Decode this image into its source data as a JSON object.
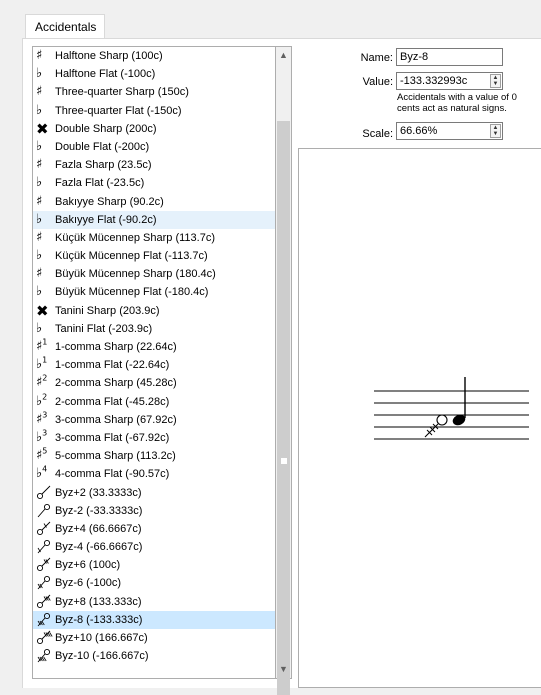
{
  "tab": {
    "label": "Accidentals"
  },
  "form": {
    "name_label": "Name:",
    "name_value": "Byz-8",
    "value_label": "Value:",
    "value_value": "-133.332993c",
    "value_note": "Accidentals with a value of 0 cents act as natural signs.",
    "scale_label": "Scale:",
    "scale_value": "66.66%"
  },
  "list": {
    "items": [
      {
        "symbol": "♯",
        "label": "Halftone Sharp (100c)",
        "sym_icon": "sharp-icon"
      },
      {
        "symbol": "♭",
        "label": "Halftone Flat (-100c)",
        "sym_icon": "flat-icon"
      },
      {
        "symbol": "♯",
        "label": "Three-quarter Sharp (150c)",
        "sym_icon": "three-quarter-sharp-icon"
      },
      {
        "symbol": "♭",
        "label": "Three-quarter Flat (-150c)",
        "sym_icon": "three-quarter-flat-icon"
      },
      {
        "symbol": "✖",
        "label": "Double Sharp (200c)",
        "sym_icon": "double-sharp-icon"
      },
      {
        "symbol": "♭",
        "label": "Double Flat (-200c)",
        "sym_icon": "double-flat-icon"
      },
      {
        "symbol": "♯",
        "label": "Fazla Sharp (23.5c)",
        "sym_icon": "fazla-sharp-icon"
      },
      {
        "symbol": "♭",
        "label": "Fazla Flat (-23.5c)",
        "sym_icon": "fazla-flat-icon"
      },
      {
        "symbol": "♯",
        "label": "Bakıyye Sharp (90.2c)",
        "sym_icon": "bakiyye-sharp-icon"
      },
      {
        "symbol": "♭",
        "label": "Bakıyye Flat (-90.2c)",
        "sym_icon": "bakiyye-flat-icon"
      },
      {
        "symbol": "♯",
        "label": "Küçük Mücennep Sharp (113.7c)",
        "sym_icon": "kucuk-mucennep-sharp-icon"
      },
      {
        "symbol": "♭",
        "label": "Küçük Mücennep Flat (-113.7c)",
        "sym_icon": "kucuk-mucennep-flat-icon"
      },
      {
        "symbol": "♯",
        "label": "Büyük Mücennep Sharp (180.4c)",
        "sym_icon": "buyuk-mucennep-sharp-icon"
      },
      {
        "symbol": "♭",
        "label": "Büyük Mücennep Flat (-180.4c)",
        "sym_icon": "buyuk-mucennep-flat-icon"
      },
      {
        "symbol": "✖",
        "label": "Tanini Sharp (203.9c)",
        "sym_icon": "tanini-sharp-icon"
      },
      {
        "symbol": "♭",
        "label": "Tanini Flat (-203.9c)",
        "sym_icon": "tanini-flat-icon"
      },
      {
        "symbol": "♯",
        "sup": "1",
        "label": "1-comma Sharp (22.64c)",
        "sym_icon": "comma-sharp-icon"
      },
      {
        "symbol": "♭",
        "sup": "1",
        "label": "1-comma Flat (-22.64c)",
        "sym_icon": "comma-flat-icon"
      },
      {
        "symbol": "♯",
        "sup": "2",
        "label": "2-comma Sharp (45.28c)",
        "sym_icon": "comma-sharp-icon"
      },
      {
        "symbol": "♭",
        "sup": "2",
        "label": "2-comma Flat (-45.28c)",
        "sym_icon": "comma-flat-icon"
      },
      {
        "symbol": "♯",
        "sup": "3",
        "label": "3-comma Sharp (67.92c)",
        "sym_icon": "comma-sharp-icon"
      },
      {
        "symbol": "♭",
        "sup": "3",
        "label": "3-comma Flat (-67.92c)",
        "sym_icon": "comma-flat-icon"
      },
      {
        "symbol": "♯",
        "sup": "5",
        "label": "5-comma Sharp (113.2c)",
        "sym_icon": "comma-sharp-icon"
      },
      {
        "symbol": "♭",
        "sup": "4",
        "label": "4-comma Flat (-90.57c)",
        "sym_icon": "comma-flat-icon"
      },
      {
        "label": "Byz+2 (33.3333c)",
        "sym_icon": "byzantine-sharp-icon",
        "svg": "up",
        "hatch": 0
      },
      {
        "label": "Byz-2 (-33.3333c)",
        "sym_icon": "byzantine-flat-icon",
        "svg": "down",
        "hatch": 0
      },
      {
        "label": "Byz+4 (66.6667c)",
        "sym_icon": "byzantine-sharp-icon",
        "svg": "up",
        "hatch": 1
      },
      {
        "label": "Byz-4 (-66.6667c)",
        "sym_icon": "byzantine-flat-icon",
        "svg": "down",
        "hatch": 1
      },
      {
        "label": "Byz+6 (100c)",
        "sym_icon": "byzantine-sharp-icon",
        "svg": "up",
        "hatch": 2
      },
      {
        "label": "Byz-6 (-100c)",
        "sym_icon": "byzantine-flat-icon",
        "svg": "down",
        "hatch": 2
      },
      {
        "label": "Byz+8 (133.333c)",
        "sym_icon": "byzantine-sharp-icon",
        "svg": "up",
        "hatch": 3
      },
      {
        "label": "Byz-8 (-133.333c)",
        "sym_icon": "byzantine-flat-icon",
        "svg": "down",
        "hatch": 3
      },
      {
        "label": "Byz+10 (166.667c)",
        "sym_icon": "byzantine-sharp-icon",
        "svg": "up",
        "hatch": 4
      },
      {
        "label": "Byz-10 (-166.667c)",
        "sym_icon": "byzantine-flat-icon",
        "svg": "down",
        "hatch": 4
      }
    ],
    "soft_selected_index": 9,
    "selected_index": 31
  },
  "colors": {
    "selection": "#cce8ff",
    "hover": "#e5f1fb"
  }
}
